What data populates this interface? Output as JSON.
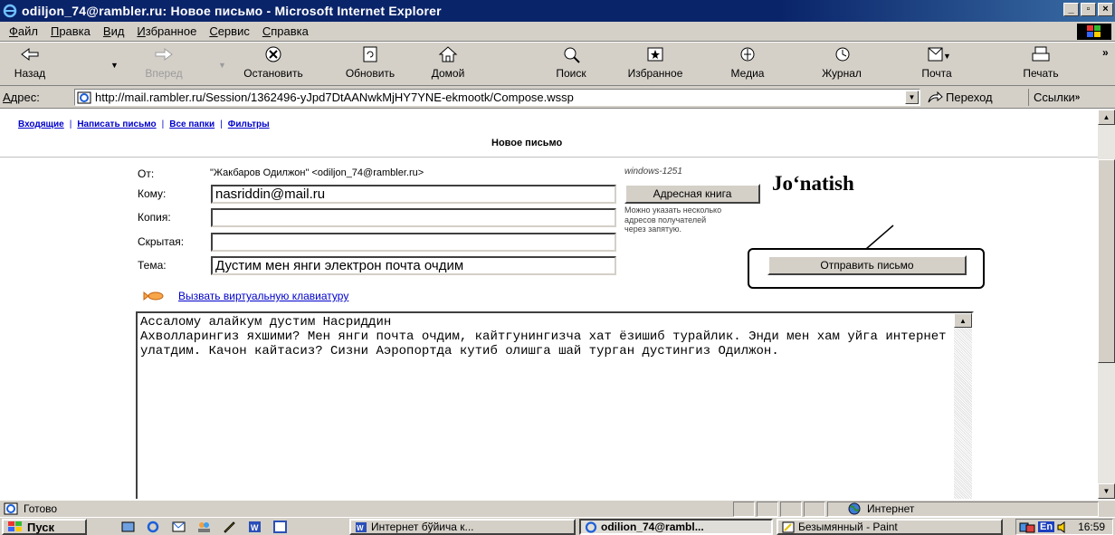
{
  "window": {
    "title": "odiljon_74@rambler.ru: Новое письмо - Microsoft Internet Explorer",
    "buttons": [
      "_",
      "▫",
      "×"
    ]
  },
  "menu": [
    "Файл",
    "Правка",
    "Вид",
    "Избранное",
    "Сервис",
    "Справка"
  ],
  "toolbar": {
    "back": "Назад",
    "forward": "Вперед",
    "stop": "Остановить",
    "refresh": "Обновить",
    "home": "Домой",
    "search": "Поиск",
    "favorites": "Избранное",
    "media": "Медиа",
    "history": "Журнал",
    "mail": "Почта",
    "print": "Печать"
  },
  "address": {
    "label": "Адрес:",
    "url": "http://mail.rambler.ru/Session/1362496-yJpd7DtAANwkMjHY7YNE-ekmootk/Compose.wssp",
    "go": "Переход",
    "links": "Ссылки"
  },
  "page": {
    "nav": [
      "Входящие",
      "Написать письмо",
      "Все папки",
      "Фильтры"
    ],
    "nav_sep": "|",
    "title": "Новое письмо",
    "from_label": "От:",
    "from_value": "\"Жакбаров Одилжон\" <odiljon_74@rambler.ru>",
    "encoding": "windows-1251",
    "to_label": "Кому:",
    "to_value": "nasriddin@mail.ru",
    "cc_label": "Копия:",
    "cc_value": "",
    "bcc_label": "Скрытая:",
    "bcc_value": "",
    "subject_label": "Тема:",
    "subject_value": "Дустим мен янги электрон почта очдим",
    "addressbook_button": "Адресная книга",
    "hint": "Можно указать несколько адресов получателей через запятую.",
    "send_button": "Отправить письмо",
    "annotation": "Jo‘natish",
    "keyboard_link": "Вызвать виртуальную клавиатуру",
    "message": "Ассалому алайкум дустим Насриддин\nАхволларингиз яхшими? Мен янги почта очдим, кайтгунингизча хат ёзишиб турайлик. Энди мен хам уйга интернет улатдим. Качон кайтасиз? Сизни Аэропортда кутиб олишга шай турган дустингиз Одилжон."
  },
  "status": {
    "text": "Готово",
    "zone": "Интернет"
  },
  "taskbar": {
    "start": "Пуск",
    "tasks": [
      "Интернет бўйича к...",
      "odilion_74@rambl...",
      "Безымянный - Paint"
    ],
    "lang": "En",
    "clock": "16:59"
  }
}
